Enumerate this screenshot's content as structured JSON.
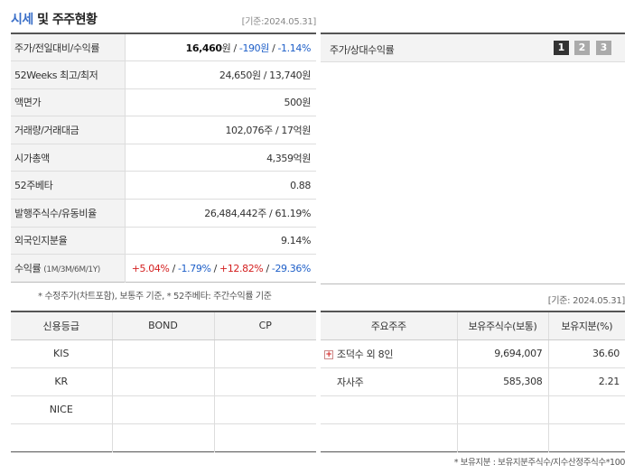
{
  "header": {
    "title_accent": "시세",
    "title_rest": " 및 주주현황",
    "date": "[기준:2024.05.31]"
  },
  "summary": {
    "rows": [
      {
        "label": "주가/전일대비/수익률"
      },
      {
        "label": "52Weeks 최고/최저",
        "value": "24,650원 / 13,740원"
      },
      {
        "label": "액면가",
        "value": "500원"
      },
      {
        "label": "거래량/거래대금",
        "value": "102,076주 / 17억원"
      },
      {
        "label": "시가총액",
        "value": "4,359억원"
      },
      {
        "label": "52주베타",
        "value": "0.88"
      },
      {
        "label": "발행주식수/유동비율",
        "value": "26,484,442주 / 61.19%"
      },
      {
        "label": "외국인지분율",
        "value": "9.14%"
      },
      {
        "label": "수익률",
        "label_sub": "(1M/3M/6M/1Y)"
      }
    ],
    "price": {
      "price": "16,460",
      "price_unit": "원",
      "sep": " / ",
      "change": "-190원",
      "change_pct": "-1.14%"
    },
    "returns": {
      "m1": "+5.04%",
      "m3": "-1.79%",
      "m6": "+12.82%",
      "y1": "-29.36%",
      "sep": " / "
    },
    "note": "* 수정주가(차트포함), 보통주 기준, * 52주베타: 주간수익률 기준"
  },
  "chart_panel": {
    "label": "주가/상대수익률",
    "pages": [
      "1",
      "2",
      "3"
    ],
    "active_page": "1"
  },
  "holders_date": "[기준: 2024.05.31]",
  "credit": {
    "headers": [
      "신용등급",
      "BOND",
      "CP"
    ],
    "rows": [
      [
        "KIS",
        "",
        ""
      ],
      [
        "KR",
        "",
        ""
      ],
      [
        "NICE",
        "",
        ""
      ],
      [
        "",
        "",
        ""
      ]
    ]
  },
  "holders": {
    "headers": [
      "주요주주",
      "보유주식수(보통)",
      "보유지분(%)"
    ],
    "rows": [
      {
        "name": "조덕수 외 8인",
        "shares": "9,694,007",
        "pct": "36.60",
        "expandable": true
      },
      {
        "name": "자사주",
        "shares": "585,308",
        "pct": "2.21",
        "expandable": false
      },
      {
        "name": "",
        "shares": "",
        "pct": ""
      },
      {
        "name": "",
        "shares": "",
        "pct": ""
      }
    ],
    "note": "* 보유지분 : 보유지분주식수/지수산정주식수*100"
  },
  "colors": {
    "accent": "#3a6fc8",
    "up": "#d42020",
    "down": "#1e5fc8"
  }
}
